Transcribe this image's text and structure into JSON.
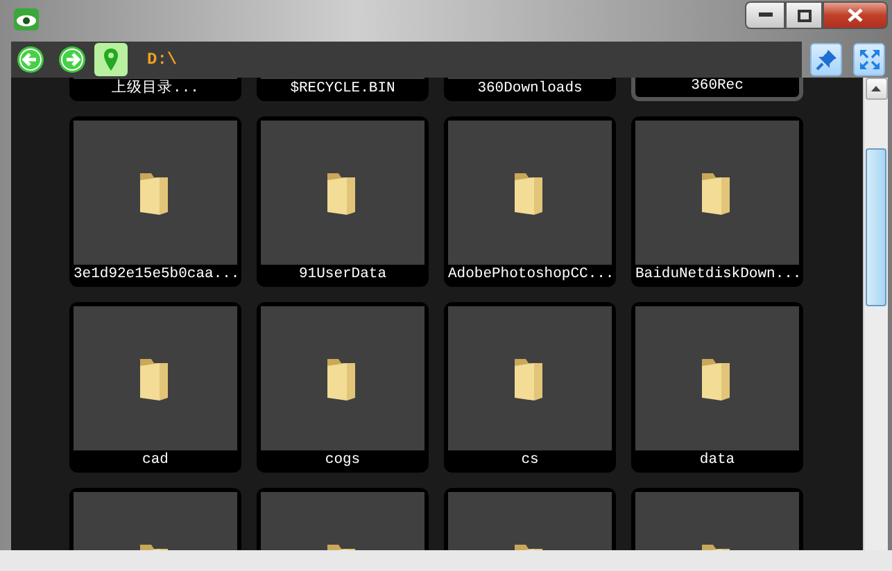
{
  "toolbar": {
    "path": "D:\\"
  },
  "items": [
    {
      "name": "上级目录...",
      "kind": "parent",
      "selected": false
    },
    {
      "name": "$RECYCLE.BIN",
      "kind": "folder",
      "selected": false
    },
    {
      "name": "360Downloads",
      "kind": "folder",
      "selected": false
    },
    {
      "name": "360Rec",
      "kind": "folder",
      "selected": true
    },
    {
      "name": "3e1d92e15e5b0caa...",
      "kind": "folder",
      "selected": false
    },
    {
      "name": "91UserData",
      "kind": "folder",
      "selected": false
    },
    {
      "name": "AdobePhotoshopCC...",
      "kind": "folder",
      "selected": false
    },
    {
      "name": "BaiduNetdiskDown...",
      "kind": "folder",
      "selected": false
    },
    {
      "name": "cad",
      "kind": "folder",
      "selected": false
    },
    {
      "name": "cogs",
      "kind": "folder",
      "selected": false
    },
    {
      "name": "cs",
      "kind": "folder",
      "selected": false
    },
    {
      "name": "data",
      "kind": "folder",
      "selected": false
    },
    {
      "kind": "folder",
      "selected": false
    },
    {
      "kind": "folder",
      "selected": false
    },
    {
      "kind": "folder",
      "selected": false
    },
    {
      "kind": "folder",
      "selected": false
    }
  ]
}
